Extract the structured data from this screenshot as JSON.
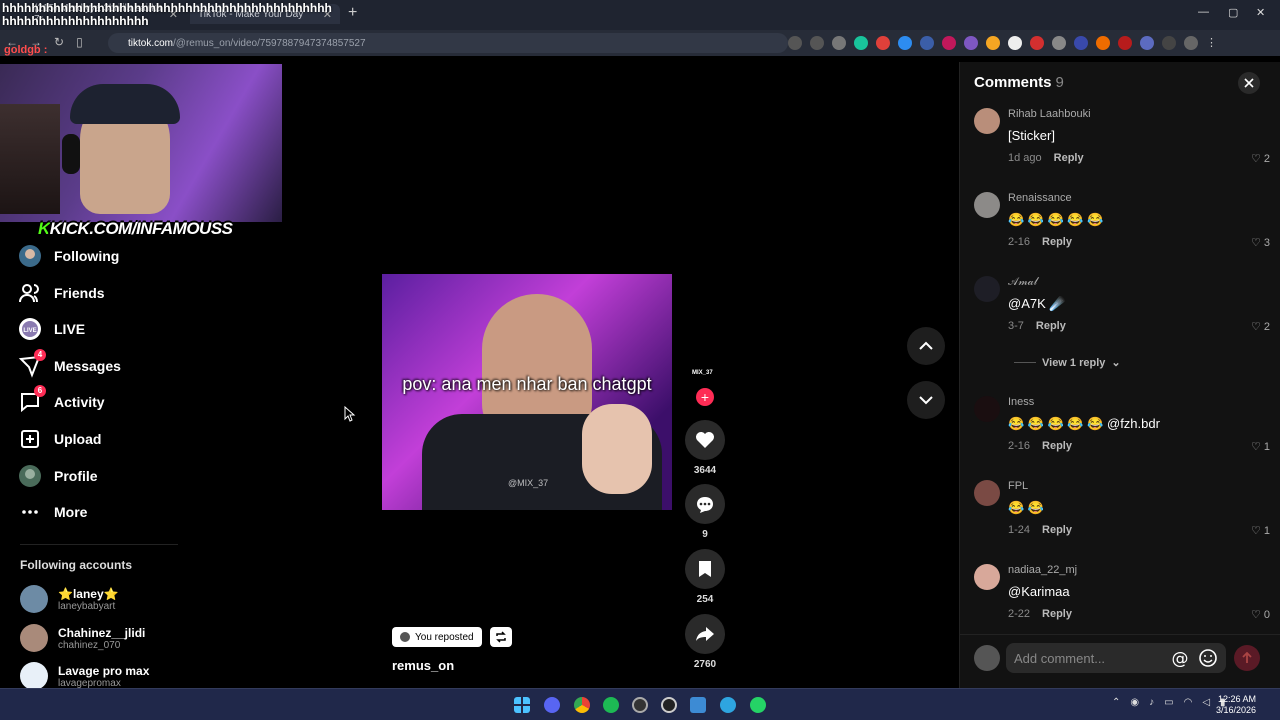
{
  "browser": {
    "tabs": [
      {
        "label": "(215) Merdiyya 3briiila sairka 7r"
      },
      {
        "label": "TikTok - Make Your Day"
      }
    ],
    "url_host": "tiktok.com",
    "url_path": "/@remus_on/video/7597887947374857527"
  },
  "overlay": {
    "marquee": "hhhhhhhhhhhhhhhhhhhhhhhhhhhhhhhhhhhhhhhhhhhhhhhhhhhhhhhhhhhhhhhhh",
    "chat_user": "goldgb :",
    "kick_k": "K",
    "kick_text": "KICK.COM/INFAMOUSS"
  },
  "sidebar": {
    "items": [
      {
        "label": "Following",
        "icon": "following-icon"
      },
      {
        "label": "Friends",
        "icon": "friends-icon"
      },
      {
        "label": "LIVE",
        "icon": "live-icon"
      },
      {
        "label": "Messages",
        "icon": "messages-icon",
        "badge": "4"
      },
      {
        "label": "Activity",
        "icon": "activity-icon",
        "badge": "6"
      },
      {
        "label": "Upload",
        "icon": "upload-icon"
      },
      {
        "label": "Profile",
        "icon": "profile-icon"
      },
      {
        "label": "More",
        "icon": "more-icon"
      }
    ],
    "following_title": "Following accounts",
    "accounts": [
      {
        "name": "⭐laney⭐",
        "handle": "laneybabyart"
      },
      {
        "name": "Chahinez__jlidi",
        "handle": "chahinez_070"
      },
      {
        "name": "Lavage pro max",
        "handle": "lavagepromax"
      }
    ]
  },
  "video": {
    "caption": "pov: ana men nhar ban chatgpt",
    "watermark": "@MIX_37",
    "creator_tag": "MIX_37",
    "likes": "3644",
    "comments": "9",
    "saves": "254",
    "shares": "2760",
    "reposted_label": "You reposted",
    "author": "remus_on"
  },
  "comments": {
    "title": "Comments",
    "count": "9",
    "items": [
      {
        "user": "Rihab Laahbouki",
        "text": "[Sticker]",
        "date": "1d ago",
        "reply": "Reply",
        "likes": "2"
      },
      {
        "user": "Renaissance",
        "text": "😂 😂 😂 😂 😂",
        "date": "2-16",
        "reply": "Reply",
        "likes": "3"
      },
      {
        "user": "𝒜𝓂𝒶𝓁",
        "text": "@A7K ☄️",
        "date": "3-7",
        "reply": "Reply",
        "likes": "2"
      },
      {
        "user": "Iness",
        "text": "😂 😂 😂 😂 😂 @fzh.bdr",
        "date": "2-16",
        "reply": "Reply",
        "likes": "1"
      },
      {
        "user": "FPL",
        "text": "😂 😂",
        "date": "1-24",
        "reply": "Reply",
        "likes": "1"
      },
      {
        "user": "nadiaa_22_mj",
        "text": "@Karimaa",
        "date": "2-22",
        "reply": "Reply",
        "likes": "0"
      }
    ],
    "view_reply": "View 1 reply",
    "input_placeholder": "Add comment..."
  },
  "taskbar": {
    "time": "12:26 AM",
    "date": "3/16/2026"
  },
  "colors": {
    "accent": "#fe2c55",
    "kick_green": "#53fc18"
  }
}
